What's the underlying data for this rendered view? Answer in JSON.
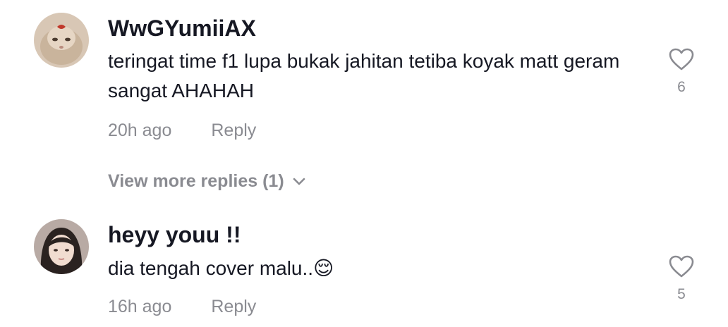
{
  "comments": [
    {
      "username": "WwGYumiiAX",
      "text": "teringat time f1 lupa bukak jahitan tetiba koyak matt geram sangat AHAHAH",
      "time": "20h ago",
      "reply_label": "Reply",
      "like_count": "6",
      "view_more_replies": "View more replies (1)"
    },
    {
      "username": "heyy youu !!",
      "text": "dia tengah cover malu..😌",
      "time": "16h ago",
      "reply_label": "Reply",
      "like_count": "5"
    }
  ],
  "icons": {
    "like": "heart-outline-icon",
    "expand": "chevron-down-icon"
  },
  "colors": {
    "text_primary": "#161823",
    "text_secondary": "#8a8b91",
    "background": "#ffffff"
  }
}
